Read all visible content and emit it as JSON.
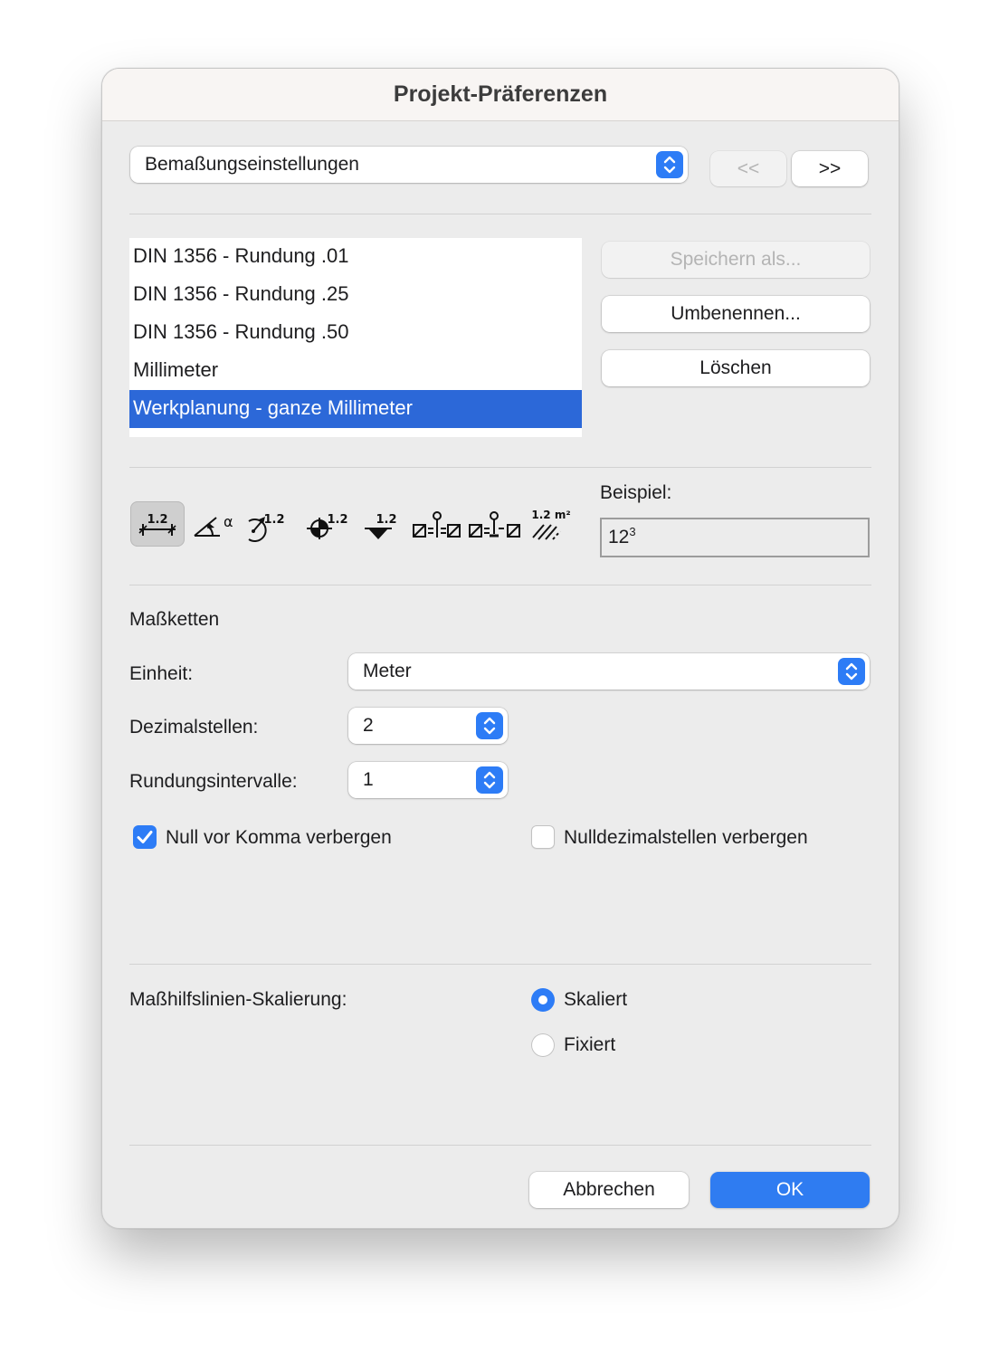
{
  "window": {
    "title": "Projekt-Präferenzen"
  },
  "category_select": {
    "value": "Bemaßungseinstellungen"
  },
  "nav": {
    "prev": "<<",
    "next": ">>"
  },
  "presets": {
    "items": [
      {
        "label": "DIN 1356 - Rundung .01",
        "selected": false
      },
      {
        "label": "DIN 1356 - Rundung .25",
        "selected": false
      },
      {
        "label": "DIN 1356 - Rundung .50",
        "selected": false
      },
      {
        "label": "Millimeter",
        "selected": false
      },
      {
        "label": "Werkplanung - ganze Millimeter",
        "selected": true
      }
    ],
    "save_as": "Speichern als...",
    "rename": "Umbenennen...",
    "delete": "Löschen"
  },
  "dimension_types": {
    "icons": [
      {
        "name": "linear-dimension-icon",
        "label": "1.2",
        "selected": true
      },
      {
        "name": "angle-dimension-icon",
        "label": "α",
        "selected": false
      },
      {
        "name": "radial-dimension-icon",
        "label": "1.2",
        "selected": false
      },
      {
        "name": "level-dimension-icon",
        "label": "1.2",
        "selected": false
      },
      {
        "name": "elevation-dimension-icon",
        "label": "1.2",
        "selected": false
      },
      {
        "name": "door-window-dimension-icon",
        "label": "",
        "selected": false
      },
      {
        "name": "sill-height-dimension-icon",
        "label": "",
        "selected": false
      },
      {
        "name": "area-dimension-icon",
        "label": "1.2 m²",
        "selected": false
      }
    ]
  },
  "example": {
    "label": "Beispiel:",
    "value": "12",
    "superscript": "3"
  },
  "chains": {
    "heading": "Maßketten",
    "unit_label": "Einheit:",
    "unit_value": "Meter",
    "decimals_label": "Dezimalstellen:",
    "decimals_value": "2",
    "rounding_label": "Rundungsintervalle:",
    "rounding_value": "1",
    "hide_leading_zero": {
      "label": "Null vor Komma verbergen",
      "checked": true
    },
    "hide_trailing_zeros": {
      "label": "Nulldezimalstellen verbergen",
      "checked": false
    }
  },
  "scaling": {
    "label": "Maßhilfslinien-Skalierung:",
    "options": [
      {
        "label": "Skaliert",
        "selected": true
      },
      {
        "label": "Fixiert",
        "selected": false
      }
    ]
  },
  "footer": {
    "cancel": "Abbrechen",
    "ok": "OK"
  },
  "colors": {
    "accent": "#2d7cf6",
    "selection": "#2c68d8"
  }
}
